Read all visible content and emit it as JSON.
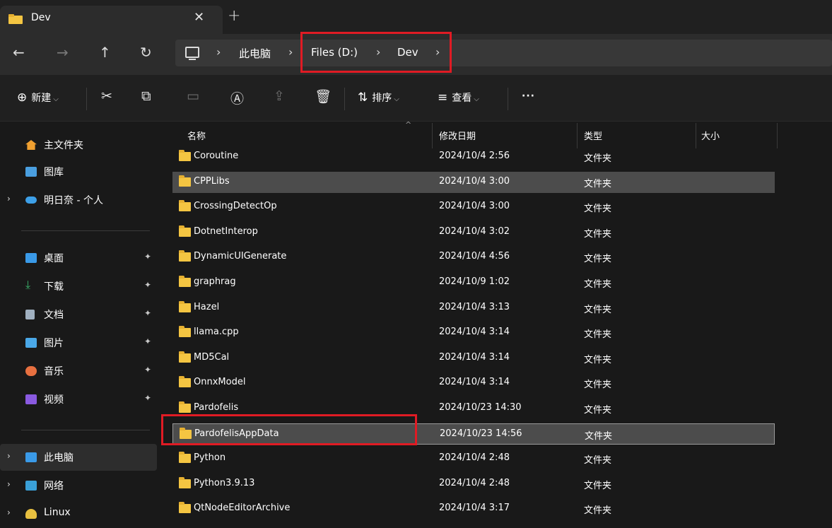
{
  "window": {
    "tab_title": "Dev",
    "close_glyph": "✕",
    "new_tab_glyph": "+"
  },
  "nav": {
    "back": "←",
    "forward": "→",
    "up": "↑",
    "refresh": "↻",
    "crumbs": [
      "此电脑",
      "Files (D:)",
      "Dev"
    ],
    "sep": "›"
  },
  "toolbar": {
    "new_label": "新建",
    "sort_label": "排序",
    "view_label": "查看",
    "more": "···",
    "icons": [
      "plus-circle-icon",
      "cut-icon",
      "copy-icon",
      "paste-icon",
      "rename-icon",
      "share-icon",
      "delete-icon",
      "sort-icon",
      "view-icon"
    ]
  },
  "sidebar": {
    "top": [
      {
        "label": "主文件夹",
        "icon": "home-icon",
        "color": "#f0a030"
      },
      {
        "label": "图库",
        "icon": "gallery-icon",
        "color": "#4a9fe0"
      },
      {
        "label": "明日奈 - 个人",
        "icon": "cloud-icon",
        "color": "#3da0e8",
        "expandable": true
      }
    ],
    "pinned": [
      {
        "label": "桌面",
        "icon": "desktop-icon",
        "color": "#3a9ae8"
      },
      {
        "label": "下载",
        "icon": "download-icon",
        "color": "#3ab06a"
      },
      {
        "label": "文档",
        "icon": "document-icon",
        "color": "#a0b0c0"
      },
      {
        "label": "图片",
        "icon": "picture-icon",
        "color": "#4aa8e8"
      },
      {
        "label": "音乐",
        "icon": "music-icon",
        "color": "#e87040"
      },
      {
        "label": "视频",
        "icon": "video-icon",
        "color": "#8a5ae0"
      }
    ],
    "pin_glyph": "📌",
    "bottom": [
      {
        "label": "此电脑",
        "icon": "computer-icon",
        "color": "#3a9ae8"
      },
      {
        "label": "网络",
        "icon": "network-icon",
        "color": "#3aa0d8"
      },
      {
        "label": "Linux",
        "icon": "linux-icon",
        "color": "#e8c040"
      }
    ]
  },
  "columns": {
    "name": "名称",
    "date": "修改日期",
    "type": "类型",
    "size": "大小"
  },
  "files": [
    {
      "name": "Coroutine",
      "date": "2024/10/4 2:56",
      "type": "文件夹"
    },
    {
      "name": "CPPLibs",
      "date": "2024/10/4 3:00",
      "type": "文件夹"
    },
    {
      "name": "CrossingDetectOp",
      "date": "2024/10/4 3:00",
      "type": "文件夹"
    },
    {
      "name": "DotnetInterop",
      "date": "2024/10/4 3:02",
      "type": "文件夹"
    },
    {
      "name": "DynamicUIGenerate",
      "date": "2024/10/4 4:56",
      "type": "文件夹"
    },
    {
      "name": "graphrag",
      "date": "2024/10/9 1:02",
      "type": "文件夹"
    },
    {
      "name": "Hazel",
      "date": "2024/10/4 3:13",
      "type": "文件夹"
    },
    {
      "name": "llama.cpp",
      "date": "2024/10/4 3:14",
      "type": "文件夹"
    },
    {
      "name": "MD5Cal",
      "date": "2024/10/4 3:14",
      "type": "文件夹"
    },
    {
      "name": "OnnxModel",
      "date": "2024/10/4 3:14",
      "type": "文件夹"
    },
    {
      "name": "Pardofelis",
      "date": "2024/10/23 14:30",
      "type": "文件夹"
    },
    {
      "name": "PardofelisAppData",
      "date": "2024/10/23 14:56",
      "type": "文件夹"
    },
    {
      "name": "Python",
      "date": "2024/10/4 2:48",
      "type": "文件夹"
    },
    {
      "name": "Python3.9.13",
      "date": "2024/10/4 2:48",
      "type": "文件夹"
    },
    {
      "name": "QtNodeEditorArchive",
      "date": "2024/10/4 3:17",
      "type": "文件夹"
    }
  ]
}
